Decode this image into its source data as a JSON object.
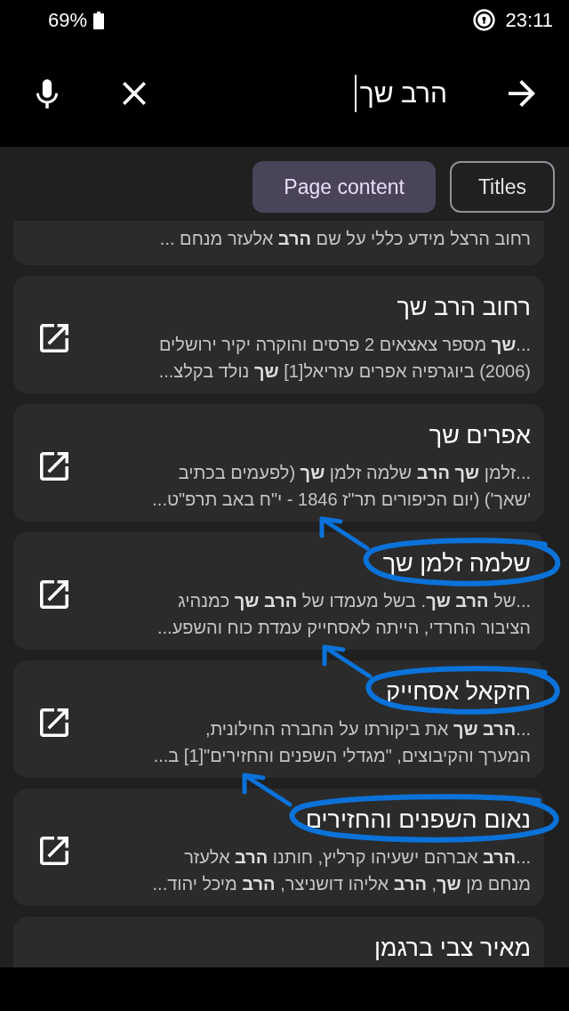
{
  "status_bar": {
    "battery_percent": "69%",
    "time": "23:11"
  },
  "search_bar": {
    "query": "הרב שך"
  },
  "filters": [
    {
      "label": "Titles",
      "selected": false
    },
    {
      "label": "Page content",
      "selected": true
    }
  ],
  "results": [
    {
      "kind": "cut_top",
      "snippet": "רחוב הרצל מידע כללי על שם **הרב** אלעזר מנחם ..."
    },
    {
      "kind": "full",
      "title": "רחוב הרב שך",
      "snippet": "...**שך** מספר צאצאים 2 פרסים והוקרה יקיר ירושלים\n(2006) ביוגרפיה אפרים עזריאל[1] **שך** נולד בקלצ...",
      "circled": false
    },
    {
      "kind": "full",
      "title": "אפרים שך",
      "snippet": "...זלמן **שך הרב** שלמה זלמן **שך** (לפעמים בכתיב\n'שאך') (יום הכיפורים תר\"ז 1846 - י\"ח באב תרפ\"ט...",
      "circled": false
    },
    {
      "kind": "full",
      "title": "שלמה זלמן שך",
      "snippet": "...של **הרב שך**. בשל מעמדו של **הרב שך** כמנהיג\nהציבור החרדי, הייתה לאסחייק עמדת כוח והשפע...",
      "circled": true
    },
    {
      "kind": "full",
      "title": "חזקאל אסחייק",
      "snippet": "...**הרב שך** את ביקורתו על החברה החילונית,\nהמערך והקיבוצים, \"מגדלי השפנים והחזירים\"[1] ב...",
      "circled": true
    },
    {
      "kind": "full",
      "title": "נאום השפנים והחזירים",
      "snippet": "...**הרב** אברהם ישעיהו קרליץ, חותנו **הרב** אלעזר\nמנחם מן **שך**, **הרב** אליהו דושניצר, **הרב** מיכל יהוד...",
      "circled": true
    },
    {
      "kind": "cut_bottom",
      "title": "מאיר צבי ברגמן",
      "circled": false
    }
  ]
}
